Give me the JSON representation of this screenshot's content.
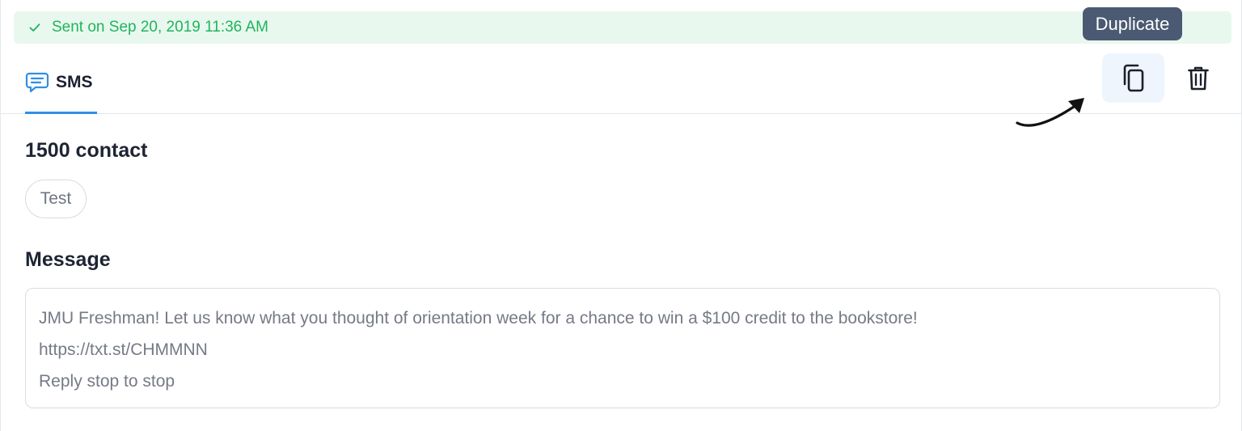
{
  "status": {
    "text": "Sent on Sep 20, 2019 11:36 AM",
    "icon": "check-icon",
    "color": "#22b35e",
    "background": "#e8f8ee"
  },
  "tabs": [
    {
      "label": "SMS",
      "icon": "chat-bubble-icon",
      "active": true
    }
  ],
  "actions": {
    "duplicate": {
      "icon": "duplicate-icon",
      "tooltip": "Duplicate"
    },
    "delete": {
      "icon": "trash-icon"
    }
  },
  "audience": {
    "count_label": "1500 contact",
    "tags": [
      "Test"
    ]
  },
  "message": {
    "heading": "Message",
    "lines": [
      "JMU Freshman! Let us know what you thought of orientation week for a chance to win a $100 credit to the bookstore!",
      "https://txt.st/CHMMNN",
      "Reply stop to stop"
    ]
  },
  "colors": {
    "accent": "#2f8fe5",
    "tooltip_bg": "#4b5a72"
  }
}
